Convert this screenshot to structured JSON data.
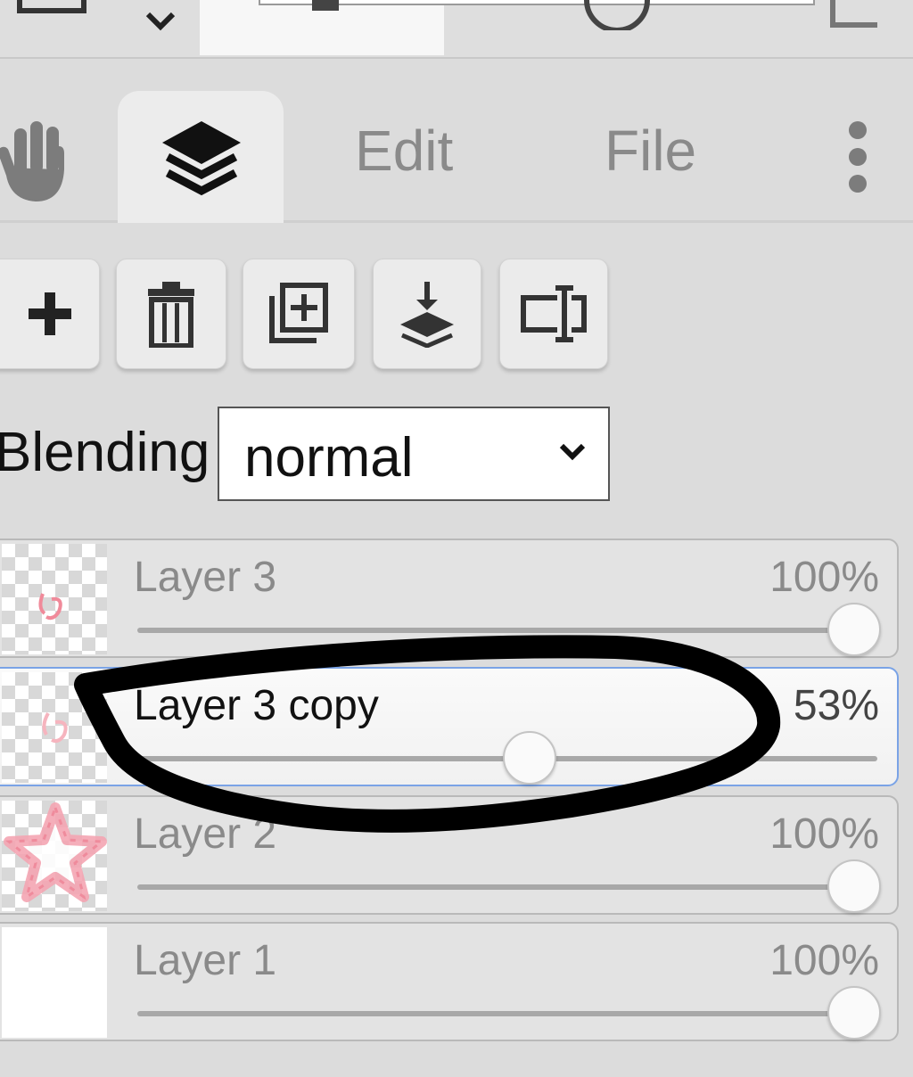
{
  "tabs": {
    "items": [
      {
        "label": "Edit"
      },
      {
        "label": "File"
      }
    ],
    "icons": [
      "hand-icon",
      "layers-icon",
      "more-vertical-icon"
    ]
  },
  "toolbar": {
    "buttons": [
      "add-layer-icon",
      "delete-layer-icon",
      "duplicate-layer-icon",
      "merge-down-icon",
      "rename-layer-icon"
    ]
  },
  "blending": {
    "label": "Blending",
    "value": "normal"
  },
  "layers": [
    {
      "name": "Layer 3",
      "opacity_label": "100%",
      "opacity": 1.0,
      "selected": false
    },
    {
      "name": "Layer 3 copy",
      "opacity_label": "53%",
      "opacity": 0.53,
      "selected": true
    },
    {
      "name": "Layer 2",
      "opacity_label": "100%",
      "opacity": 1.0,
      "selected": false
    },
    {
      "name": "Layer 1",
      "opacity_label": "100%",
      "opacity": 1.0,
      "selected": false
    }
  ],
  "colors": {
    "selected_border": "#7aa3e6",
    "annotation_stroke": "#000000",
    "thumb_pink": "#f08a9a"
  }
}
